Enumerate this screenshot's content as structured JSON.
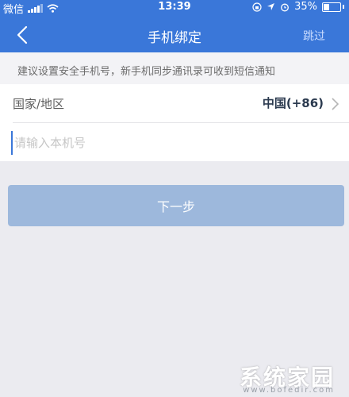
{
  "status_bar": {
    "carrier": "微信",
    "time": "13:39",
    "battery": "35%",
    "icons": [
      "signal-icon",
      "wifi-icon",
      "orientation-lock-icon",
      "location-icon",
      "alarm-icon",
      "battery-icon"
    ]
  },
  "nav": {
    "title": "手机绑定",
    "skip_label": "跳过",
    "back_icon": "chevron-left-icon"
  },
  "tip": "建议设置安全手机号，新手机同步通讯录可收到短信通知",
  "form": {
    "country_label": "国家/地区",
    "country_value": "中国(+86)",
    "phone_placeholder": "请输入本机号",
    "phone_value": ""
  },
  "next_button_label": "下一步",
  "watermark": {
    "title": "系统家园",
    "url": "www.bofedir.com"
  },
  "colors": {
    "brand_blue": "#3a77d9",
    "button_disabled": "#9db8dc",
    "background": "#ebebf0"
  }
}
